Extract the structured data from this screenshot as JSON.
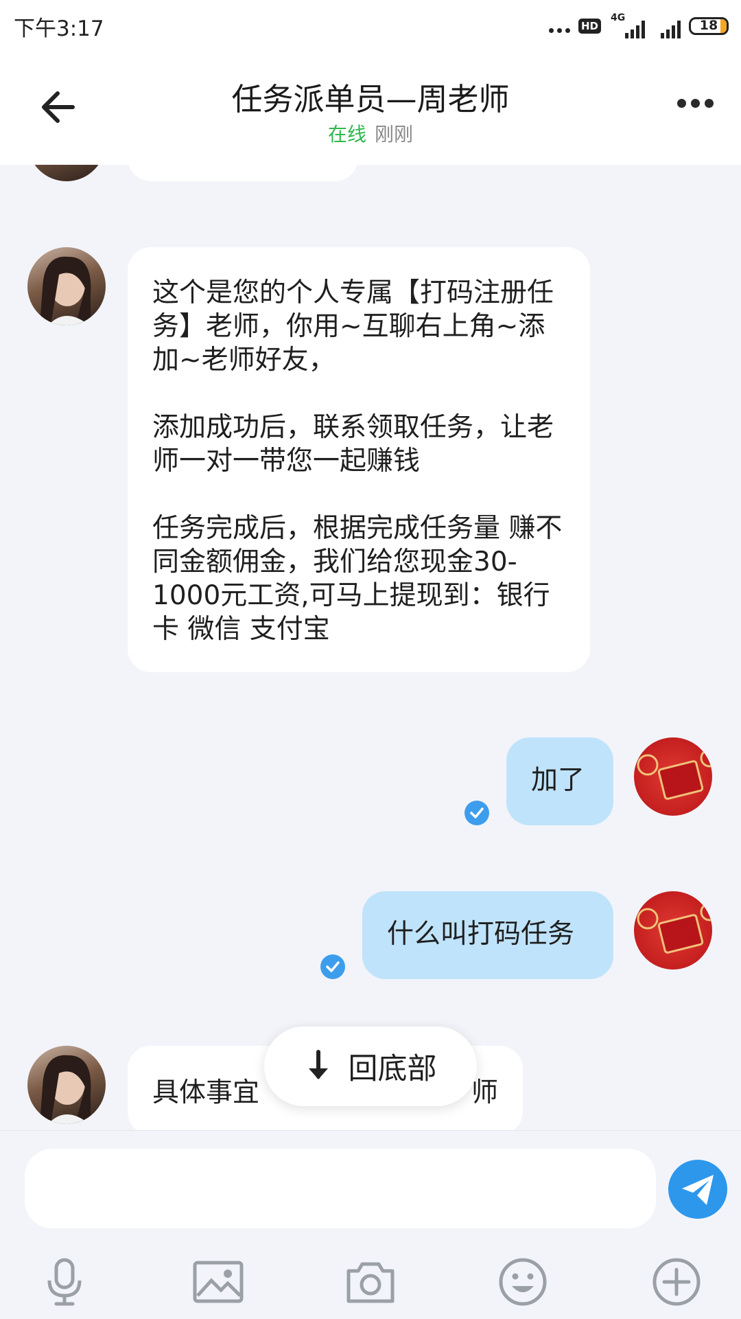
{
  "status_bar": {
    "time": "下午3:17",
    "hd": "HD",
    "network": "4G",
    "battery": "18",
    "battery_level": 0.18
  },
  "header": {
    "title": "任务派单员—周老师",
    "status_online": "在线",
    "status_last_seen": "刚刚"
  },
  "messages": [
    {
      "direction": "incoming",
      "text": "这个是您的个人专属【打码注册任务】老师，你用~互聊右上角~添加~老师好友，\n\n添加成功后，联系领取任务，让老师一对一带您一起赚钱\n\n任务完成后，根据完成任务量 赚不同金额佣金，我们给您现金30-1000元工资,可马上提现到：银行卡 微信 支付宝"
    },
    {
      "direction": "outgoing",
      "text": "加了",
      "read": true
    },
    {
      "direction": "outgoing",
      "text": "什么叫打码任务",
      "read": true
    },
    {
      "direction": "incoming",
      "text": "具体事宜",
      "text_end": "师",
      "partially_hidden": true
    }
  ],
  "jump_to_bottom": {
    "label": "回底部",
    "icon": "arrow-down-icon"
  },
  "composer": {
    "placeholder": "",
    "tools": [
      "microphone-icon",
      "image-icon",
      "camera-icon",
      "emoji-icon",
      "plus-icon"
    ],
    "send_icon": "send-icon"
  },
  "colors": {
    "online": "#2db84d",
    "outgoing_bubble": "#bfe3fb",
    "accent": "#2d97ec",
    "background": "#f2f4f9"
  }
}
